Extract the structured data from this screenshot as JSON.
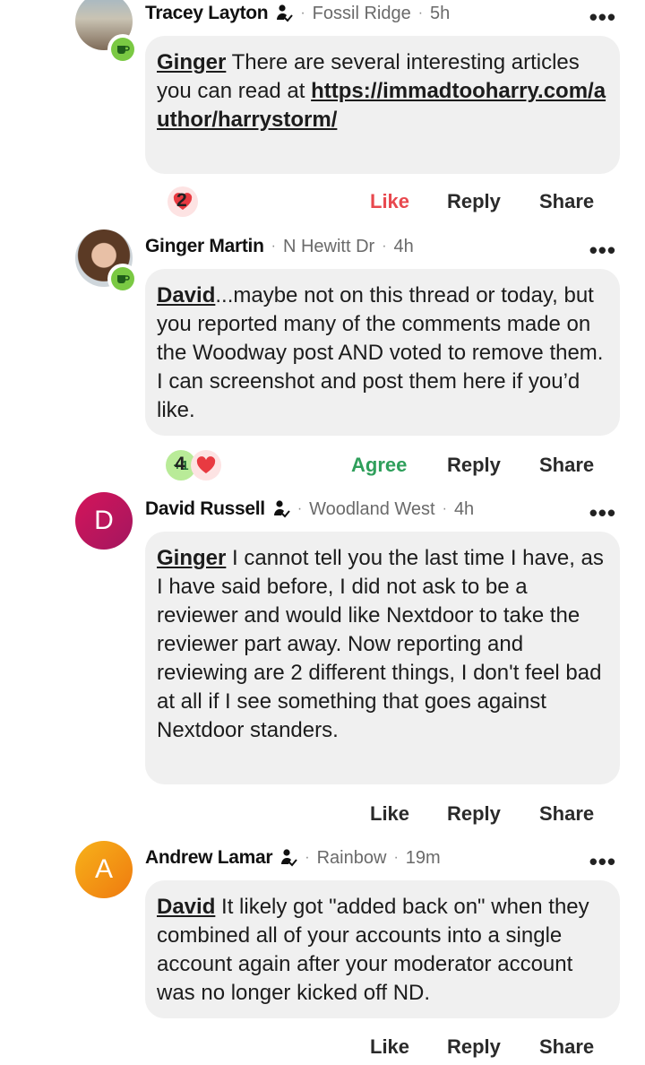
{
  "comments": [
    {
      "name": "Tracey Layton",
      "location": "Fossil Ridge",
      "time": "5h",
      "mention": "Ginger",
      "text": " There are several interesting articles you can read at ",
      "link": "https://immadtooharry.com/author/harrystorm/",
      "reaction_count": "2",
      "like_label": "Like",
      "reply_label": "Reply",
      "share_label": "Share"
    },
    {
      "name": "Ginger Martin",
      "location": "N Hewitt Dr",
      "time": "4h",
      "mention": "David",
      "text": "...maybe not on this thread or today, but you reported many of the comments made on the Woodway post AND voted to remove them. I can screenshot and post them here if you’d like.",
      "plus_one": "+1",
      "reaction_count": "4",
      "like_label": "Agree",
      "reply_label": "Reply",
      "share_label": "Share"
    },
    {
      "name": "David Russell",
      "avatar_letter": "D",
      "location": "Woodland West",
      "time": "4h",
      "mention": "Ginger",
      "text": " I cannot tell you the last time I have, as I have said before, I did not ask to be a reviewer and would like Nextdoor to take the reviewer part away.  Now reporting and reviewing are 2 different things, I don't feel bad at all if I see something that goes against Nextdoor standers.",
      "like_label": "Like",
      "reply_label": "Reply",
      "share_label": "Share"
    },
    {
      "name": "Andrew Lamar",
      "avatar_letter": "A",
      "location": "Rainbow",
      "time": "19m",
      "mention": "David",
      "text": " It likely got \"added back on\" when they combined all of your accounts into a single account again after your moderator account was no longer kicked off ND.",
      "like_label": "Like",
      "reply_label": "Reply",
      "share_label": "Share"
    }
  ],
  "separator": "·",
  "more_label": "•••",
  "colors": {
    "like_active": "#e8484e",
    "agree": "#2f9f5b",
    "bubble": "#f0f0f0",
    "helpful_badge": "#7ac943"
  }
}
